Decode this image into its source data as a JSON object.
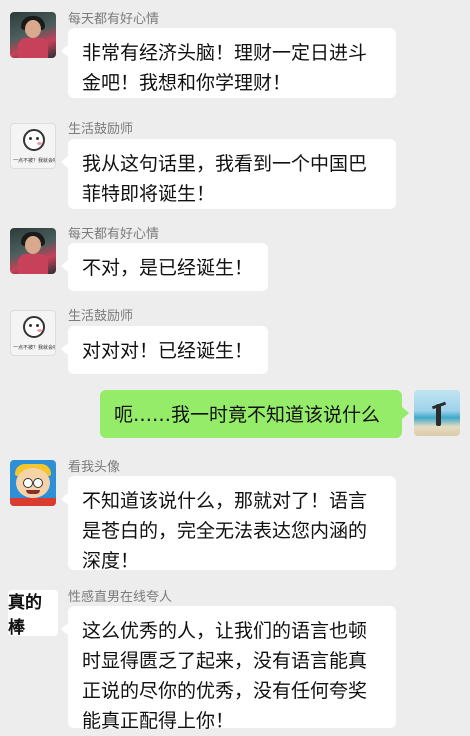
{
  "messages": [
    {
      "side": "left",
      "name": "每天都有好心情",
      "text_lines": [
        "非常有经济头脑！理财一定日进斗",
        "金吧！我想和你学理财！"
      ],
      "avatar_icon": "girl-photo-avatar"
    },
    {
      "side": "left",
      "name": "生活鼓励师",
      "text_lines": [
        "我从这句话里，我看到一个中国巴",
        "菲特即将诞生！"
      ],
      "avatar_icon": "doodle-avatar",
      "avatar_text": "一点不被？我就会呢？"
    },
    {
      "side": "left",
      "name": "每天都有好心情",
      "text_lines": [
        "不对，是已经诞生！"
      ],
      "avatar_icon": "girl-photo-avatar"
    },
    {
      "side": "left",
      "name": "生活鼓励师",
      "text_lines": [
        "对对对！已经诞生！"
      ],
      "avatar_icon": "doodle-avatar",
      "avatar_text": "一点不被？我就会呢？"
    },
    {
      "side": "right",
      "text_lines": [
        "呃……我一时竟不知道该说什么"
      ],
      "avatar_icon": "beach-photo-avatar"
    },
    {
      "side": "left",
      "name": "看我头像",
      "text_lines": [
        "不知道该说什么，那就对了！语言",
        "是苍白的，完全无法表达您内涵的",
        "深度！"
      ],
      "avatar_icon": "cartoon-avatar"
    },
    {
      "side": "left",
      "name": "性感直男在线夸人",
      "text_lines": [
        "这么优秀的人，让我们的语言也顿",
        "时显得匮乏了起来，没有语言能真",
        "正说的尽你的优秀，没有任何夸奖",
        "能真正配得上你！"
      ],
      "avatar_icon": "text-avatar",
      "avatar_text": "真的棒"
    }
  ],
  "colors": {
    "background": "#ededed",
    "bubble_left": "#ffffff",
    "bubble_right": "#95ec69"
  }
}
